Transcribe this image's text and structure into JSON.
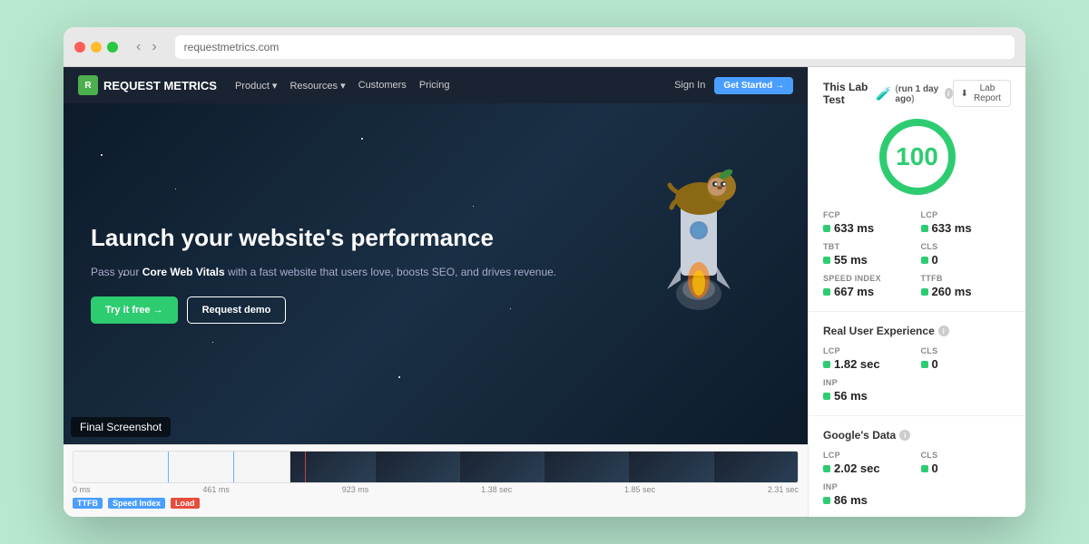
{
  "browser": {
    "address": "requestmetrics.com"
  },
  "website": {
    "nav": {
      "logo": "REQUEST METRICS",
      "links": [
        "Product ▾",
        "Resources ▾",
        "Customers",
        "Pricing"
      ],
      "signin": "Sign In",
      "cta": "Get Started →"
    },
    "hero": {
      "title": "Launch your website's performance",
      "subtitle_plain": "Pass your ",
      "subtitle_bold": "Core Web Vitals",
      "subtitle_end": " with a fast website that users love, boosts SEO, and drives revenue.",
      "btn_primary": "Try it free →",
      "btn_secondary": "Request demo"
    }
  },
  "screenshot_label": "Final Screenshot",
  "timeline": {
    "labels": [
      "0 ms",
      "461 ms",
      "923 ms",
      "1.38 sec",
      "1.85 sec",
      "2.31 sec"
    ],
    "markers": [
      {
        "label": "TTFB",
        "type": "blue"
      },
      {
        "label": "Speed Index",
        "type": "blue"
      },
      {
        "label": "Load",
        "type": "red"
      }
    ]
  },
  "metrics": {
    "lab_test": {
      "title": "This Lab Test",
      "run_info": "run 1 day ago",
      "report_btn": "Lab Report"
    },
    "score": 100,
    "vitals": [
      {
        "label": "FCP",
        "value": "633 ms",
        "dot": "green"
      },
      {
        "label": "LCP",
        "value": "633 ms",
        "dot": "green"
      },
      {
        "label": "TBT",
        "value": "55 ms",
        "dot": "green"
      },
      {
        "label": "CLS",
        "value": "0",
        "dot": "green"
      },
      {
        "label": "SPEED INDEX",
        "value": "667 ms",
        "dot": "green"
      },
      {
        "label": "TTFB",
        "value": "260 ms",
        "dot": "green"
      }
    ],
    "real_user": {
      "title": "Real User Experience",
      "metrics": [
        {
          "label": "LCP",
          "value": "1.82 sec",
          "dot": "green"
        },
        {
          "label": "CLS",
          "value": "0",
          "dot": "green"
        },
        {
          "label": "INP",
          "value": "56 ms",
          "dot": "green"
        }
      ]
    },
    "google_data": {
      "title": "Google's Data",
      "metrics": [
        {
          "label": "LCP",
          "value": "2.02 sec",
          "dot": "green"
        },
        {
          "label": "CLS",
          "value": "0",
          "dot": "green"
        },
        {
          "label": "INP",
          "value": "86 ms",
          "dot": "green"
        }
      ]
    }
  },
  "colors": {
    "green": "#2ecc71",
    "blue": "#4a9eff",
    "dark_bg": "#1a2332",
    "red": "#e74c3c"
  }
}
